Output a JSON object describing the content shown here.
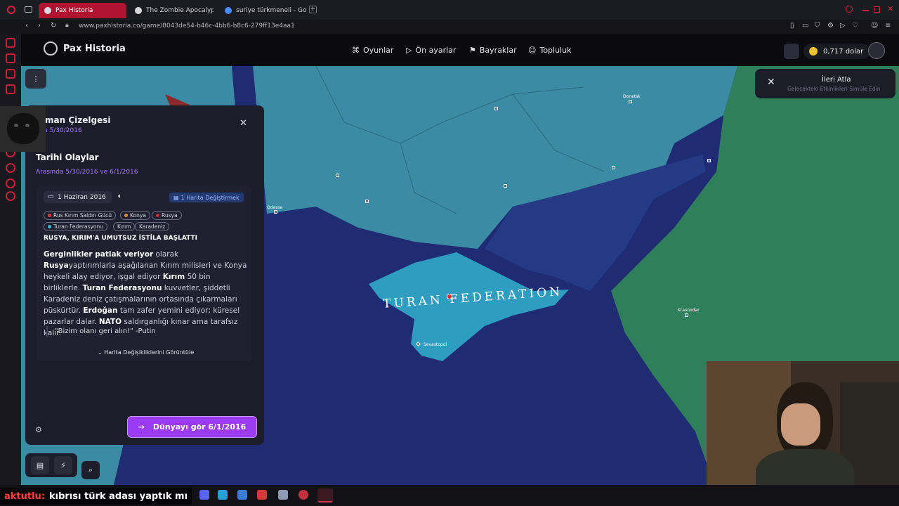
{
  "browser": {
    "tabs": [
      {
        "title": "Pax Historia",
        "active": true
      },
      {
        "title": "The Zombie Apocalypse",
        "active": false
      },
      {
        "title": "suriye türkmeneli - Googl",
        "active": false
      }
    ],
    "url": "www.paxhistoria.co/game/8043de54-b46c-4bb6-b8c6-279ff13e4aa1"
  },
  "header": {
    "brand": "Pax Historia",
    "nav": [
      {
        "label": "Oyunlar",
        "icon": "gamepad-icon"
      },
      {
        "label": "Ön ayarlar",
        "icon": "play-icon"
      },
      {
        "label": "Bayraklar",
        "icon": "flag-icon"
      },
      {
        "label": "Topluluk",
        "icon": "people-icon"
      }
    ],
    "balance": "0,717 dolar"
  },
  "toast": {
    "title": "İleri Atla",
    "subtitle": "Gelecekteki Etkinlikleri Simüle Edin"
  },
  "panel": {
    "title": "man Çizelgesi",
    "current_date": "n 5/30/2016",
    "section_title": "Tarihi Olaylar",
    "range": "Arasında 5/30/2016 ve 6/1/2016",
    "event": {
      "date": "1 Haziran 2016",
      "map_changes_badge": "1 Harita Değiştirmek",
      "tags": [
        {
          "label": "Rus Kırım Saldırı Gücü",
          "dot": "#e23b3b"
        },
        {
          "label": "Konya",
          "dot": "#e08a2a"
        },
        {
          "label": "Rusya",
          "dot": "#c43434"
        },
        {
          "label": "Turan Federasyonu",
          "dot": "#3bb6d6"
        },
        {
          "label": "Kırım",
          "dot": ""
        },
        {
          "label": "Karadeniz",
          "dot": ""
        }
      ],
      "headline": "RUSYA, KIRIM'A UMUTSUZ İSTİLA BAŞLATTI",
      "body": [
        {
          "t": "Gerginlikler patlak veriyor",
          "b": true
        },
        {
          "t": " olarak ",
          "b": false
        },
        {
          "t": "Rusya",
          "b": true
        },
        {
          "t": "yaptırımlarla aşağılanan Kırım milisleri ve Konya heykeli alay ediyor, işgal ediyor ",
          "b": false
        },
        {
          "t": "Kırım",
          "b": true
        },
        {
          "t": " 50 bin birliklerle. ",
          "b": false
        },
        {
          "t": "Turan Federasyonu",
          "b": true
        },
        {
          "t": " kuvvetler, şiddetli Karadeniz deniz çatışmalarının ortasında çıkarmaları püskürtür. ",
          "b": false
        },
        {
          "t": "Erdoğan",
          "b": true
        },
        {
          "t": " tam zafer yemini ediyor; küresel pazarlar dalar. ",
          "b": false
        },
        {
          "t": "NATO",
          "b": true
        },
        {
          "t": " saldırganlığı kınar ama tarafsız kalır.",
          "b": false
        }
      ],
      "quote": "\"Bizim olanı geri alın!\" -Putin",
      "show_changes": "Harita Değişikliklerini Görüntüle"
    },
    "cta": "Dünyayı gör 6/1/2016"
  },
  "map": {
    "territory_label": "TURAN FEDERATION",
    "cities": [
      {
        "name": "Sevastopol"
      },
      {
        "name": "Krasnodar"
      },
      {
        "name": "Odessa"
      },
      {
        "name": "Donetsk"
      }
    ],
    "colors": {
      "sea": "#1f2b72",
      "turan": "#2e9dbf",
      "ukraine": "#3a8ba3",
      "russia": "#2f7f5a"
    }
  },
  "stream_chat": {
    "user": "aktutlu:",
    "message": "kıbrısı türk adası yaptık mı"
  }
}
